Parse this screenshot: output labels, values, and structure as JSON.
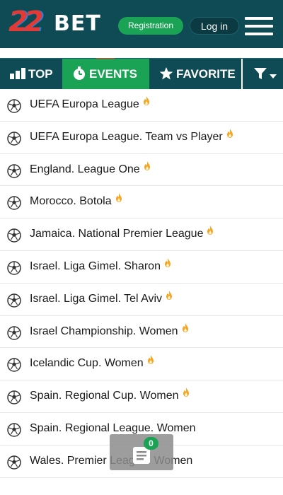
{
  "header": {
    "logo_number": "22",
    "logo_word": "BET",
    "registration_label": "Registration",
    "login_label": "Log in"
  },
  "tabs": {
    "top_label": "TOP",
    "events_label": "EVENTS",
    "favorites_label": "FAVORITE"
  },
  "leagues": [
    {
      "name": "UEFA Europa League",
      "hot": true
    },
    {
      "name": "UEFA Europa League. Team vs Player",
      "hot": true
    },
    {
      "name": "England. League One",
      "hot": true
    },
    {
      "name": "Morocco. Botola",
      "hot": true
    },
    {
      "name": "Jamaica. National Premier League",
      "hot": true
    },
    {
      "name": "Israel. Liga Gimel. Sharon",
      "hot": true
    },
    {
      "name": "Israel. Liga Gimel. Tel Aviv",
      "hot": true
    },
    {
      "name": "Israel Championship. Women",
      "hot": true
    },
    {
      "name": "Icelandic Cup. Women",
      "hot": true
    },
    {
      "name": "Spain. Regional Cup. Women",
      "hot": true
    },
    {
      "name": "Spain. Regional League. Women",
      "hot": false
    },
    {
      "name": "Wales. Premier League. Women",
      "hot": false
    }
  ],
  "betslip": {
    "count": "0"
  },
  "colors": {
    "header_bg": "#0f4b55",
    "accent_green": "#1aa355",
    "fire_orange": "#f5a623"
  },
  "icons": {
    "sport": "soccer-ball-icon",
    "hot": "fire-icon"
  }
}
